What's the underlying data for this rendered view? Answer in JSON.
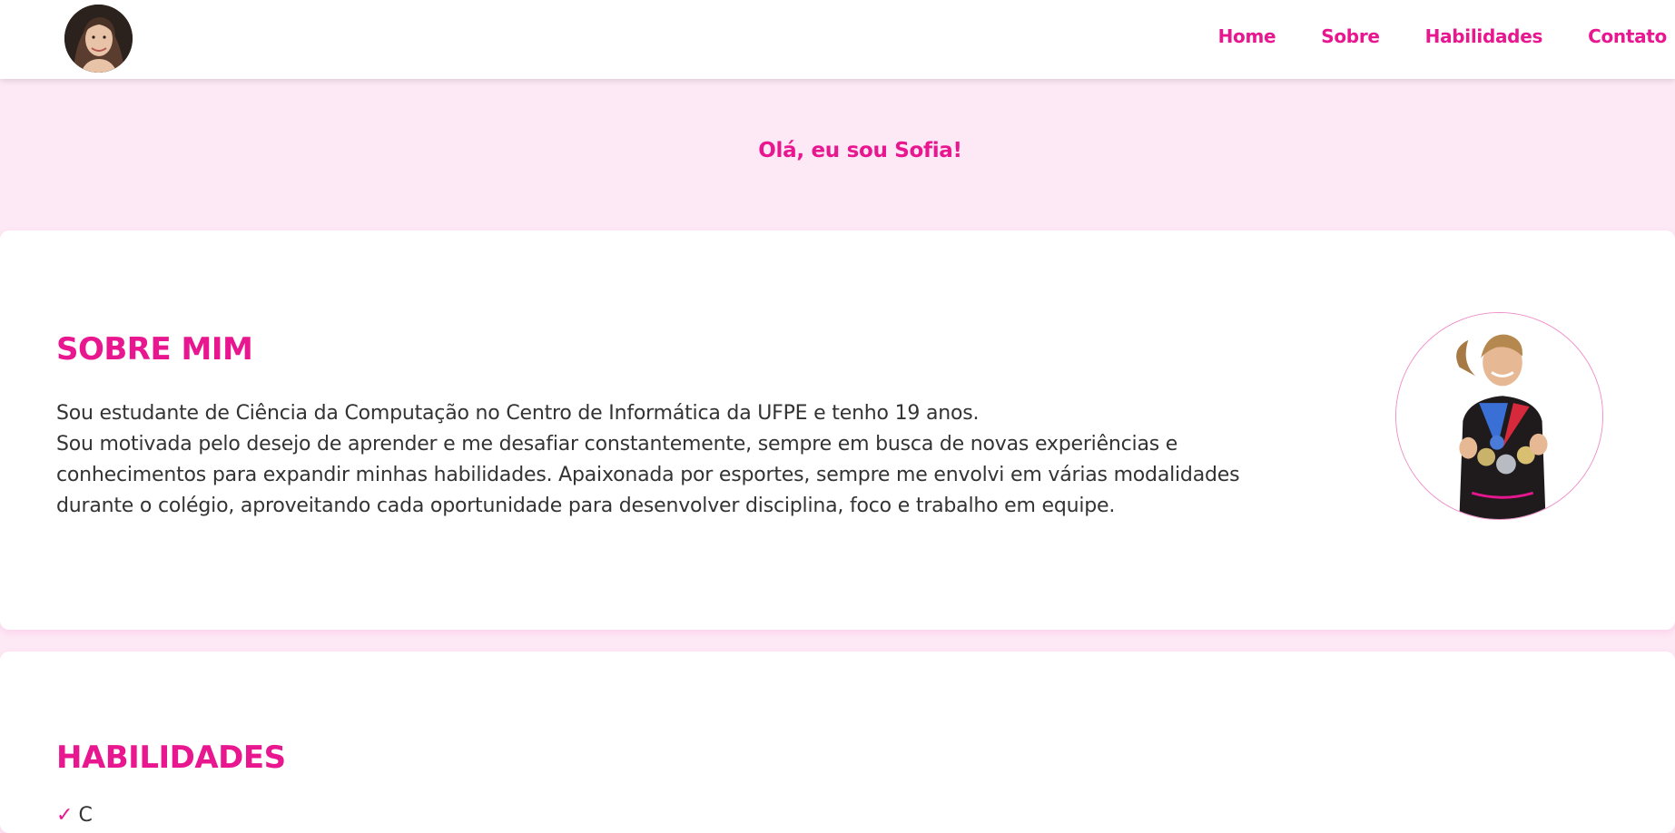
{
  "nav": {
    "links": [
      "Home",
      "Sobre",
      "Habilidades",
      "Contato"
    ]
  },
  "hero": {
    "title": "Olá, eu sou Sofia!"
  },
  "about": {
    "title": "SOBRE MIM",
    "line1": "Sou estudante de Ciência da Computação no Centro de Informática da UFPE e tenho 19 anos.",
    "line2": "Sou motivada pelo desejo de aprender e me desafiar constantemente, sempre em busca de novas experiências e conhecimentos para expandir minhas habilidades. Apaixonada por esportes, sempre me envolvi em várias modalidades durante o colégio, aproveitando cada oportunidade para desenvolver disciplina, foco e trabalho em equipe."
  },
  "skills": {
    "title": "HABILIDADES",
    "items": [
      "C"
    ]
  },
  "colors": {
    "accent": "#e8178f",
    "background": "#fde8f5",
    "card": "#ffffff",
    "text": "#333333"
  }
}
